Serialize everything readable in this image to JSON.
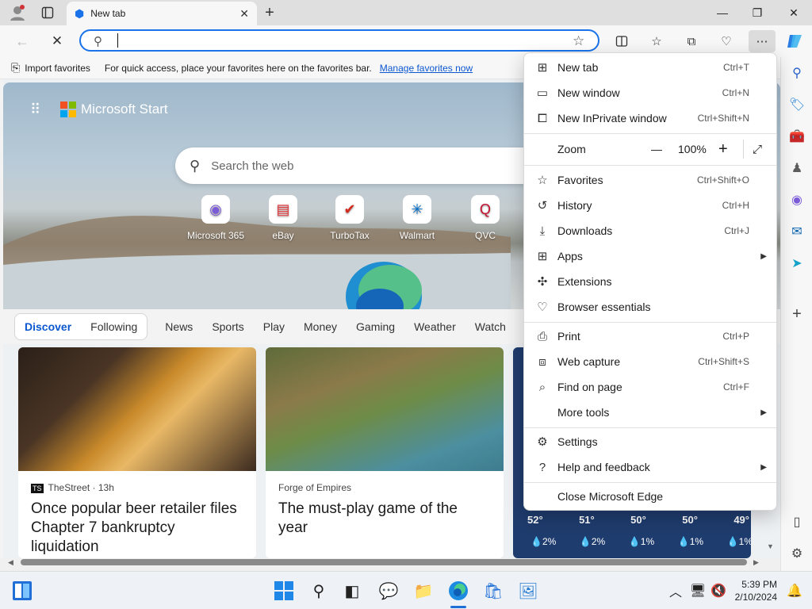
{
  "browser": {
    "tab_title": "New tab",
    "address_value": "",
    "favorites_bar": {
      "import_label": "Import favorites",
      "message": "For quick access, place your favorites here on the favorites bar.",
      "manage_link": "Manage favorites now"
    }
  },
  "newtab": {
    "brand": "Microsoft Start",
    "search_placeholder": "Search the web",
    "quick_links": [
      {
        "label": "Microsoft 365"
      },
      {
        "label": "eBay"
      },
      {
        "label": "TurboTax"
      },
      {
        "label": "Walmart"
      },
      {
        "label": "QVC"
      }
    ],
    "feed_tabs": [
      "Discover",
      "Following"
    ],
    "feed_nav": [
      "News",
      "Sports",
      "Play",
      "Money",
      "Gaming",
      "Weather",
      "Watch"
    ],
    "cards": [
      {
        "source": "TheStreet · 13h",
        "source_badge": "TS",
        "headline": "Once popular beer retailer files Chapter 7 bankruptcy liquidation"
      },
      {
        "source": "Forge of Empires",
        "headline": "The must-play game of the year"
      }
    ],
    "weather": {
      "temps": [
        "52°",
        "51°",
        "50°",
        "50°",
        "49°"
      ],
      "precip": [
        "2%",
        "2%",
        "1%",
        "1%",
        "1%"
      ]
    }
  },
  "menu": {
    "items": [
      {
        "label": "New tab",
        "shortcut": "Ctrl+T"
      },
      {
        "label": "New window",
        "shortcut": "Ctrl+N"
      },
      {
        "label": "New InPrivate window",
        "shortcut": "Ctrl+Shift+N"
      },
      {
        "label": "Favorites",
        "shortcut": "Ctrl+Shift+O"
      },
      {
        "label": "History",
        "shortcut": "Ctrl+H"
      },
      {
        "label": "Downloads",
        "shortcut": "Ctrl+J"
      },
      {
        "label": "Apps",
        "shortcut": ""
      },
      {
        "label": "Extensions",
        "shortcut": ""
      },
      {
        "label": "Browser essentials",
        "shortcut": ""
      },
      {
        "label": "Print",
        "shortcut": "Ctrl+P"
      },
      {
        "label": "Web capture",
        "shortcut": "Ctrl+Shift+S"
      },
      {
        "label": "Find on page",
        "shortcut": "Ctrl+F"
      },
      {
        "label": "More tools",
        "shortcut": ""
      },
      {
        "label": "Settings",
        "shortcut": ""
      },
      {
        "label": "Help and feedback",
        "shortcut": ""
      },
      {
        "label": "Close Microsoft Edge",
        "shortcut": ""
      }
    ],
    "zoom": {
      "label": "Zoom",
      "value": "100%",
      "minus": "—",
      "plus": "+"
    }
  },
  "taskbar": {
    "time": "5:39 PM",
    "date": "2/10/2024"
  }
}
